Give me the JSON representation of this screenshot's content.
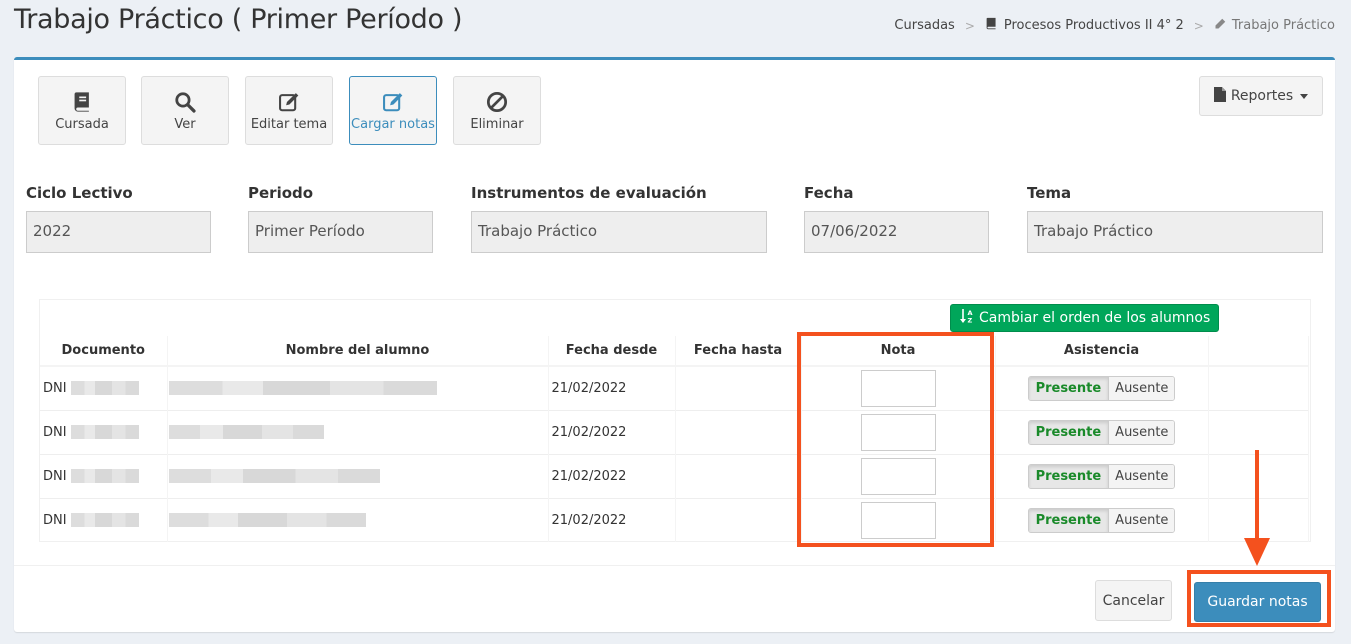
{
  "header": {
    "title": "Trabajo Práctico ( Primer Período )",
    "breadcrumb": [
      {
        "label": "Cursadas",
        "icon": ""
      },
      {
        "label": "Procesos Productivos II 4° 2",
        "icon": "book-icon"
      },
      {
        "label": "Trabajo Práctico",
        "icon": "pencil-icon"
      }
    ]
  },
  "toolbar": {
    "buttons": [
      {
        "label": "Cursada",
        "icon": "book-icon"
      },
      {
        "label": "Ver",
        "icon": "search-icon"
      },
      {
        "label": "Editar tema",
        "icon": "edit-icon"
      },
      {
        "label": "Cargar notas",
        "icon": "edit-icon",
        "active": true
      },
      {
        "label": "Eliminar",
        "icon": "ban-icon"
      }
    ],
    "reports_label": "Reportes"
  },
  "fields": [
    {
      "label": "Ciclo Lectivo",
      "value": "2022"
    },
    {
      "label": "Periodo",
      "value": "Primer Período"
    },
    {
      "label": "Instrumentos de evaluación",
      "value": "Trabajo Práctico"
    },
    {
      "label": "Fecha",
      "value": "07/06/2022"
    },
    {
      "label": "Tema",
      "value": "Trabajo Práctico"
    }
  ],
  "table": {
    "sort_button_label": "Cambiar el orden de los alumnos",
    "columns": [
      "Documento",
      "Nombre del alumno",
      "Fecha desde",
      "Fecha hasta",
      "Nota",
      "Asistencia"
    ],
    "rows": [
      {
        "doc_prefix": "DNI",
        "fecha_desde": "21/02/2022",
        "fecha_hasta": "",
        "nota": "",
        "presente": "Presente",
        "ausente": "Ausente"
      },
      {
        "doc_prefix": "DNI",
        "fecha_desde": "21/02/2022",
        "fecha_hasta": "",
        "nota": "",
        "presente": "Presente",
        "ausente": "Ausente"
      },
      {
        "doc_prefix": "DNI",
        "fecha_desde": "21/02/2022",
        "fecha_hasta": "",
        "nota": "",
        "presente": "Presente",
        "ausente": "Ausente"
      },
      {
        "doc_prefix": "DNI",
        "fecha_desde": "21/02/2022",
        "fecha_hasta": "",
        "nota": "",
        "presente": "Presente",
        "ausente": "Ausente"
      }
    ]
  },
  "actions": {
    "cancel_label": "Cancelar",
    "save_label": "Guardar notas"
  },
  "colors": {
    "primary": "#3c8dbc",
    "success": "#00a65a",
    "highlight": "#f4511e"
  }
}
